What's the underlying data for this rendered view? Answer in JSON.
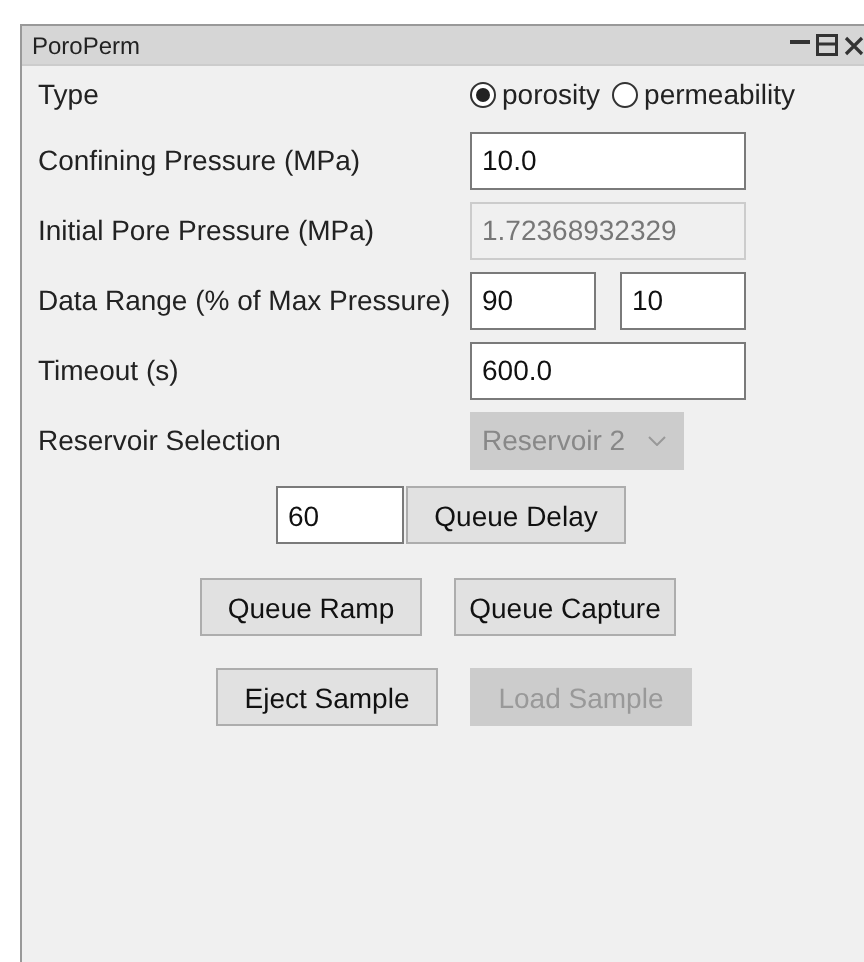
{
  "window": {
    "title": "PoroPerm"
  },
  "rows": [
    {
      "kind": "radio",
      "label": "Type",
      "options": [
        {
          "label": "porosity",
          "selected": true
        },
        {
          "label": "permeability",
          "selected": false
        }
      ]
    },
    {
      "kind": "input",
      "label": "Confining Pressure (MPa)",
      "fields": [
        {
          "value": "10.0",
          "disabled": false
        }
      ]
    },
    {
      "kind": "input",
      "label": "Initial Pore Pressure (MPa)",
      "fields": [
        {
          "value": "1.72368932329",
          "disabled": true
        }
      ]
    },
    {
      "kind": "input",
      "label": "Data Range (% of Max Pressure)",
      "fields": [
        {
          "value": "90",
          "disabled": false
        },
        {
          "value": "10",
          "disabled": false
        }
      ]
    },
    {
      "kind": "input",
      "label": "Timeout (s)",
      "fields": [
        {
          "value": "600.0",
          "disabled": false
        }
      ]
    },
    {
      "kind": "dropdown",
      "label": "Reservoir Selection",
      "value": "Reservoir 2",
      "disabled": true
    }
  ],
  "delay": {
    "value": "60",
    "button": "Queue Delay"
  },
  "button_rows": [
    [
      {
        "label": "Queue Ramp",
        "disabled": false
      },
      {
        "label": "Queue Capture",
        "disabled": false
      }
    ],
    [
      {
        "label": "Eject Sample",
        "disabled": false
      },
      {
        "label": "Load Sample",
        "disabled": true
      }
    ]
  ]
}
